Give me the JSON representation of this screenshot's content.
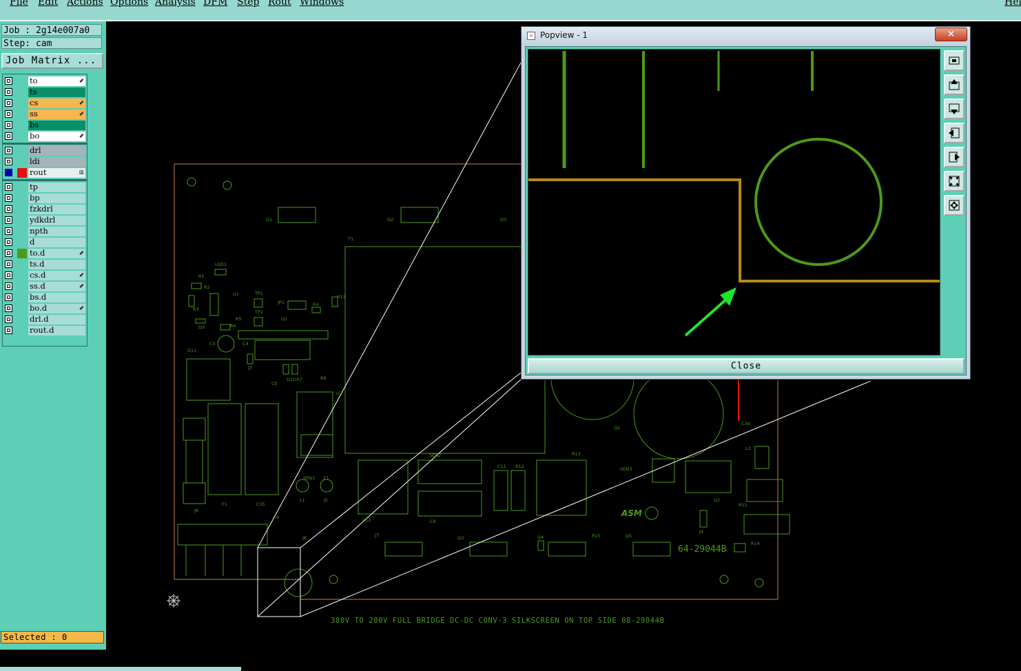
{
  "menubar": {
    "items": [
      "File",
      "Edit",
      "Actions",
      "Options",
      "Analysis",
      "DFM",
      "Step",
      "Rout",
      "Windows"
    ],
    "help": "Hel"
  },
  "job": {
    "job_label": "Job : 2g14e007a0",
    "step_label": "Step: cam",
    "matrix_button": "Job Matrix ..."
  },
  "layers": [
    {
      "name": "to",
      "color": "#ffffff",
      "marker": true
    },
    {
      "name": "ts",
      "color": "#0b8f6a",
      "marker": false
    },
    {
      "name": "cs",
      "color": "#f7b64e",
      "marker": true
    },
    {
      "name": "ss",
      "color": "#f7b64e",
      "marker": true
    },
    {
      "name": "bs",
      "color": "#0b8f6a",
      "marker": false
    },
    {
      "name": "bo",
      "color": "#ffffff",
      "marker": true
    },
    {
      "name": "drl",
      "color": "#a6b3bb",
      "marker": false
    },
    {
      "name": "ldi",
      "color": "#a6b3bb",
      "marker": false
    },
    {
      "name": "rout",
      "color": "#e8eef0",
      "marker": true
    },
    {
      "name": "tp",
      "color": "#a8dcd6",
      "marker": false
    },
    {
      "name": "bp",
      "color": "#a8dcd6",
      "marker": false
    },
    {
      "name": "fzkdrl",
      "color": "#a8dcd6",
      "marker": false
    },
    {
      "name": "ydkdrl",
      "color": "#a8dcd6",
      "marker": false
    },
    {
      "name": "npth",
      "color": "#a8dcd6",
      "marker": false
    },
    {
      "name": "d",
      "color": "#a8dcd6",
      "marker": false
    },
    {
      "name": "to.d",
      "color": "#a8dcd6",
      "marker": true
    },
    {
      "name": "ts.d",
      "color": "#a8dcd6",
      "marker": false
    },
    {
      "name": "cs.d",
      "color": "#a8dcd6",
      "marker": true
    },
    {
      "name": "ss.d",
      "color": "#a8dcd6",
      "marker": true
    },
    {
      "name": "bs.d",
      "color": "#a8dcd6",
      "marker": false
    },
    {
      "name": "bo.d",
      "color": "#a8dcd6",
      "marker": true
    },
    {
      "name": "drl.d",
      "color": "#a8dcd6",
      "marker": false
    },
    {
      "name": "rout.d",
      "color": "#a8dcd6",
      "marker": false
    }
  ],
  "selected_label": "Selected : 0",
  "board": {
    "caption": "380V TO 200V FULL BRIDGE DC-DC CONV-3   SILKSCREEN ON TOP SIDE 08-29044B",
    "part_number": "64-29044B",
    "logo": "ASM",
    "refs": [
      "D1",
      "D2",
      "D3",
      "T1",
      "LED1",
      "R1",
      "R2",
      "R3",
      "U1",
      "TP1",
      "TP2",
      "JP1",
      "R4",
      "R11",
      "Q1",
      "R6",
      "R5",
      "D5",
      "C3",
      "C4",
      "J3",
      "C5",
      "D10",
      "R7",
      "R8",
      "D11",
      "U2",
      "SEN1",
      "Z1",
      "L1",
      "J5",
      "J6",
      "F1",
      "C35",
      "C9",
      "J8",
      "C12",
      "SEN2",
      "C6",
      "C11",
      "R12",
      "R13",
      "SEN3",
      "Q2",
      "C34",
      "L3",
      "U2",
      "R11",
      "J4",
      "R14",
      "J7",
      "Q3",
      "Q4",
      "R15",
      "Q5",
      "Q8"
    ]
  },
  "popview": {
    "title": "Popview - 1",
    "close_label": "Close",
    "close_x": "×"
  },
  "colors": {
    "layer_green": "#4c9a1a",
    "rout_gold": "#b88a14",
    "arrow": "#1fe52a",
    "board_outline": "#c8824a"
  }
}
